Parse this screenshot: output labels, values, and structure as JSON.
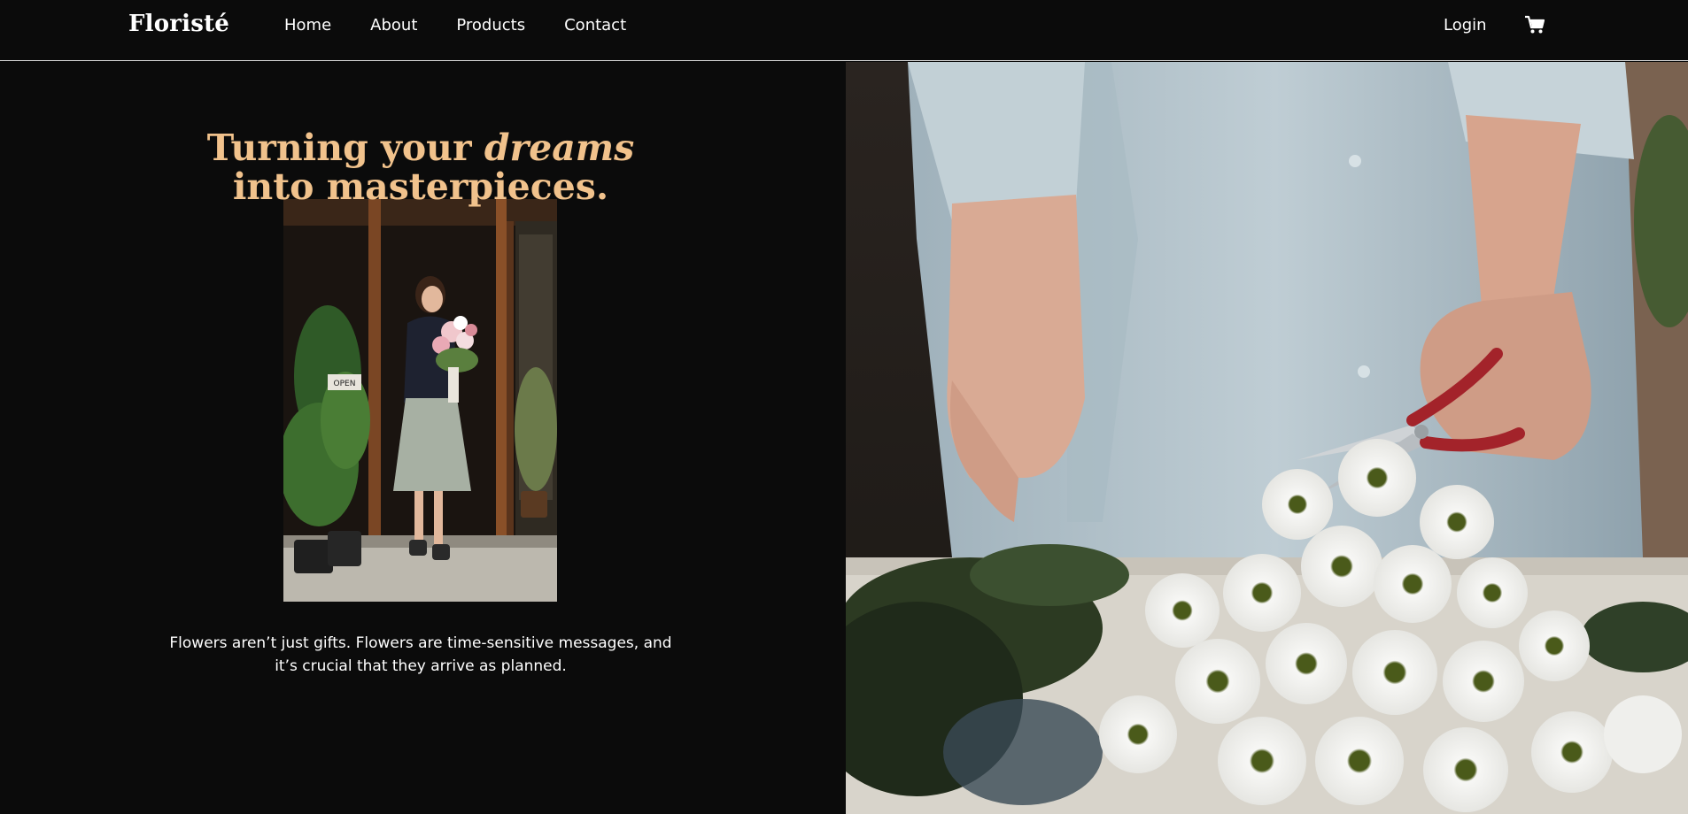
{
  "brand": {
    "name": "Floristé"
  },
  "nav": {
    "links": [
      "Home",
      "About",
      "Products",
      "Contact"
    ],
    "login": "Login",
    "cart_icon": "shopping-cart-icon"
  },
  "hero": {
    "headline_part1": "Turning your ",
    "headline_em": "dreams",
    "headline_part2": "into masterpieces.",
    "tagline_line1": "Flowers aren’t just gifts. Flowers are time-sensitive messages, and",
    "tagline_line2": "it’s crucial that they arrive as planned.",
    "shop_sign": "OPEN"
  },
  "colors": {
    "background": "#0b0b0b",
    "accent": "#f1c28c",
    "text": "#ffffff"
  }
}
